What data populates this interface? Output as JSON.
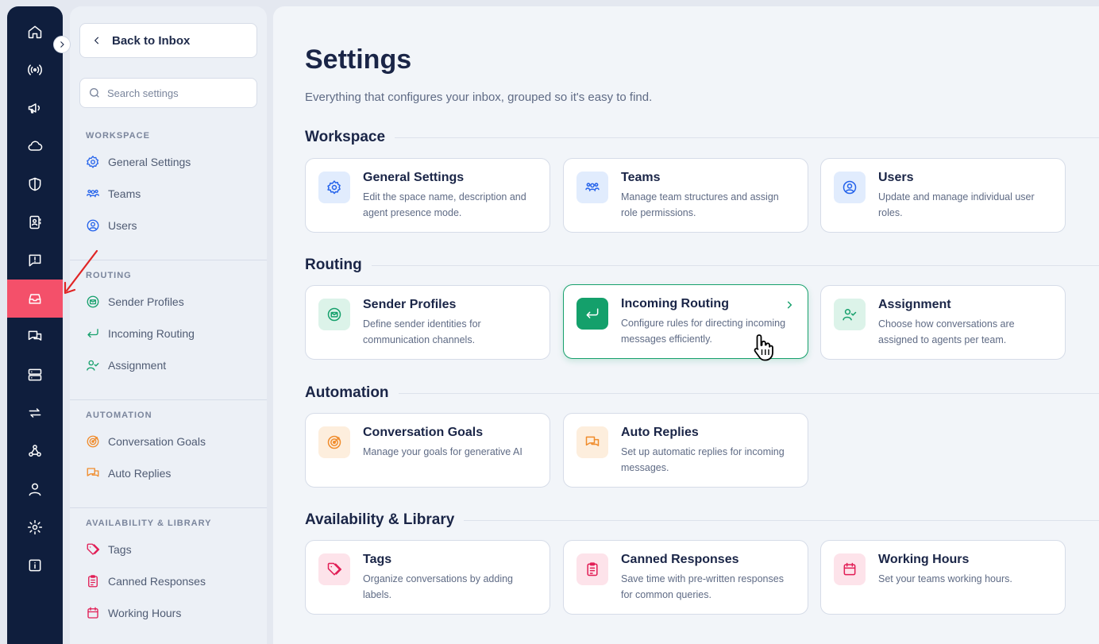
{
  "sidebar": {
    "back_label": "Back to Inbox",
    "search_placeholder": "Search settings",
    "groups": [
      {
        "label": "WORKSPACE",
        "items": [
          {
            "label": "General Settings",
            "icon": "gear-icon"
          },
          {
            "label": "Teams",
            "icon": "team-icon"
          },
          {
            "label": "Users",
            "icon": "user-circle-icon"
          }
        ]
      },
      {
        "label": "ROUTING",
        "items": [
          {
            "label": "Sender Profiles",
            "icon": "mail-icon"
          },
          {
            "label": "Incoming Routing",
            "icon": "return-arrow-icon"
          },
          {
            "label": "Assignment",
            "icon": "user-check-icon"
          }
        ]
      },
      {
        "label": "AUTOMATION",
        "items": [
          {
            "label": "Conversation Goals",
            "icon": "target-icon"
          },
          {
            "label": "Auto Replies",
            "icon": "chat-bubbles-icon"
          }
        ]
      },
      {
        "label": "AVAILABILITY & LIBRARY",
        "items": [
          {
            "label": "Tags",
            "icon": "tag-icon"
          },
          {
            "label": "Canned Responses",
            "icon": "clipboard-icon"
          },
          {
            "label": "Working Hours",
            "icon": "calendar-icon"
          }
        ]
      }
    ]
  },
  "main": {
    "title": "Settings",
    "subtitle": "Everything that configures your inbox, grouped so it's easy to find.",
    "sections": [
      {
        "title": "Workspace",
        "cards": [
          {
            "title": "General Settings",
            "desc": "Edit the space name, description and agent presence mode.",
            "icon": "gear-icon"
          },
          {
            "title": "Teams",
            "desc": "Manage team structures and assign role permissions.",
            "icon": "team-icon"
          },
          {
            "title": "Users",
            "desc": "Update and manage individual user roles.",
            "icon": "user-circle-icon"
          }
        ]
      },
      {
        "title": "Routing",
        "cards": [
          {
            "title": "Sender Profiles",
            "desc": "Define sender identities for communication channels.",
            "icon": "mail-icon"
          },
          {
            "title": "Incoming Routing",
            "desc": "Configure rules for directing incoming messages efficiently.",
            "icon": "return-arrow-icon"
          },
          {
            "title": "Assignment",
            "desc": "Choose how conversations are assigned to agents per team.",
            "icon": "user-check-icon"
          }
        ]
      },
      {
        "title": "Automation",
        "cards": [
          {
            "title": "Conversation Goals",
            "desc": "Manage your goals for generative AI",
            "icon": "target-icon"
          },
          {
            "title": "Auto Replies",
            "desc": "Set up automatic replies for incoming messages.",
            "icon": "chat-bubbles-icon"
          }
        ]
      },
      {
        "title": "Availability & Library",
        "cards": [
          {
            "title": "Tags",
            "desc": "Organize conversations by adding labels.",
            "icon": "tag-icon"
          },
          {
            "title": "Canned Responses",
            "desc": "Save time with pre-written responses for common queries.",
            "icon": "clipboard-icon"
          },
          {
            "title": "Working Hours",
            "desc": "Set your teams working hours.",
            "icon": "calendar-icon"
          }
        ]
      }
    ]
  },
  "colors": {
    "rail": "#0f1e3d",
    "rail_active": "#f4506a",
    "workspace_accent": "#2563eb",
    "routing_accent": "#16a06c",
    "automation_accent": "#f08c2c",
    "library_accent": "#e11d55"
  }
}
